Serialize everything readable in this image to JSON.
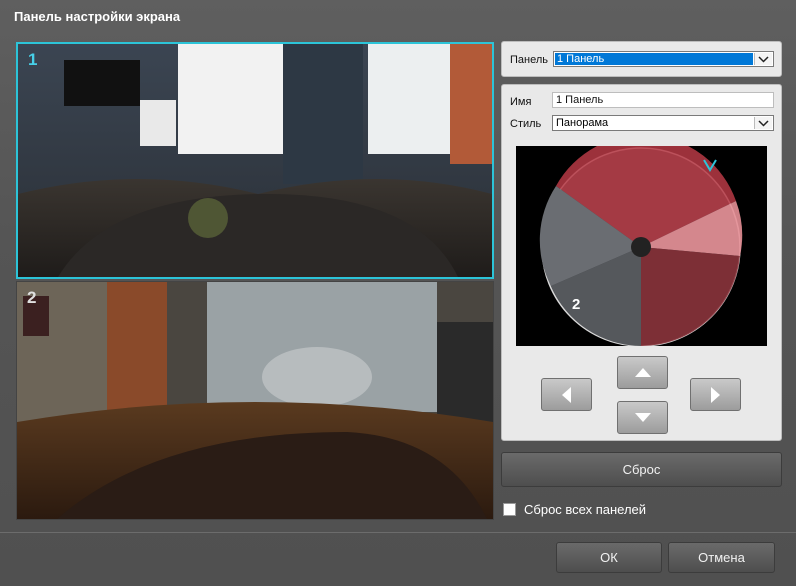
{
  "dialog": {
    "title": "Панель настройки экрана"
  },
  "views": [
    {
      "number": "1"
    },
    {
      "number": "2"
    }
  ],
  "panel": {
    "label": "Панель",
    "value": "1 Панель"
  },
  "settings": {
    "name_label": "Имя",
    "name_value": "1 Панель",
    "style_label": "Стиль",
    "style_value": "Панорама",
    "fisheye_number": "2"
  },
  "reset_button": "Сброс",
  "reset_all": {
    "label": "Сброс всех панелей",
    "checked": false
  },
  "footer": {
    "ok": "ОК",
    "cancel": "Отмена"
  },
  "colors": {
    "accent": "#2cc4d8",
    "selection": "#0078d7"
  }
}
